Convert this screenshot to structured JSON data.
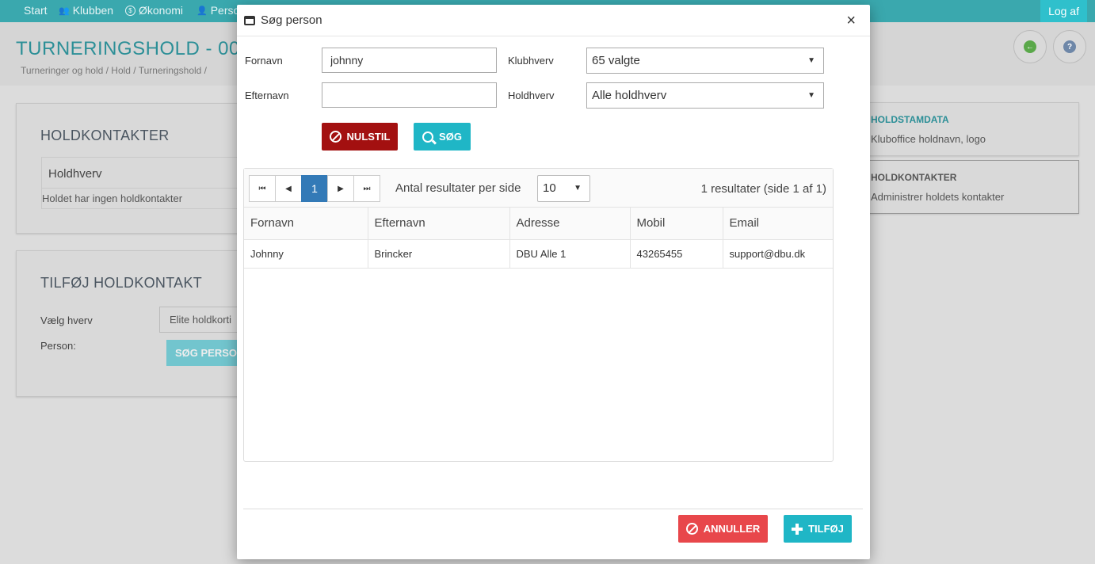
{
  "topnav": {
    "items": [
      {
        "label": "Start"
      },
      {
        "label": "Klubben"
      },
      {
        "label": "Økonomi"
      },
      {
        "label": "Perso"
      }
    ],
    "logout_label": "Log af"
  },
  "page": {
    "title": "TURNERINGSHOLD - 00",
    "breadcrumb": "Turneringer og hold / Hold / Turneringshold /"
  },
  "contacts_card": {
    "title": "HOLDKONTAKTER",
    "column_header": "Holdhverv",
    "empty_text": "Holdet har ingen holdkontakter"
  },
  "add_card": {
    "title": "TILFØJ HOLDKONTAKT",
    "role_label": "Vælg hverv",
    "role_value": "Elite holdkorti",
    "person_label": "Person:",
    "search_person_button": "SØG PERSON"
  },
  "side_menu": [
    {
      "title": "HOLDSTAMDATA",
      "subtitle": "Kluboffice holdnavn, logo"
    },
    {
      "title": "HOLDKONTAKTER",
      "subtitle": "Administrer holdets kontakter"
    }
  ],
  "modal": {
    "title": "Søg person",
    "close_glyph": "×",
    "form": {
      "firstname_label": "Fornavn",
      "firstname_value": "johnny",
      "lastname_label": "Efternavn",
      "lastname_value": "",
      "club_role_label": "Klubhverv",
      "club_role_value": "65 valgte",
      "team_role_label": "Holdhverv",
      "team_role_value": "Alle holdhverv",
      "reset_button": "NULSTIL",
      "search_button": "SØG"
    },
    "results": {
      "current_page": "1",
      "per_page_label": "Antal resultater per side",
      "per_page_value": "10",
      "count_text": "1 resultater (side 1 af 1)",
      "columns": [
        "Fornavn",
        "Efternavn",
        "Adresse",
        "Mobil",
        "Email"
      ],
      "rows": [
        [
          "Johnny",
          "Brincker",
          "DBU Alle 1",
          "43265455",
          "support@dbu.dk"
        ]
      ]
    },
    "footer": {
      "cancel_button": "ANNULLER",
      "add_button": "TILFØJ"
    }
  },
  "colors": {
    "nav": "#3aa8ae",
    "accent_teal": "#1fb6c6",
    "reset_red": "#a31010",
    "cancel_red": "#e8474b",
    "pager_active": "#337ab7"
  }
}
